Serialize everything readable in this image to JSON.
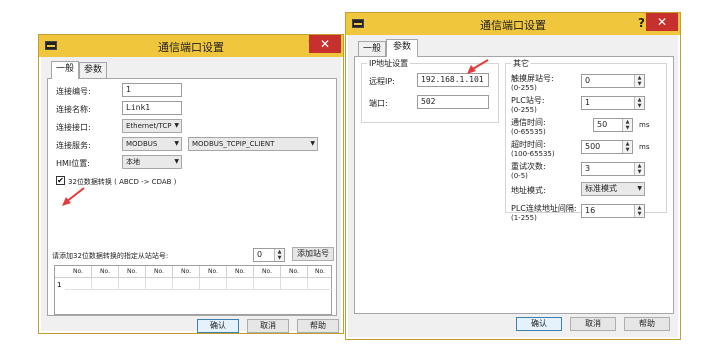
{
  "colors": {
    "titlebar": "#f0c63c",
    "close": "#c7312d",
    "arrow": "#e23b3b"
  },
  "dialog1": {
    "title": "通信端口设置",
    "help": "?",
    "close": "✕",
    "tabs": [
      "一般",
      "参数"
    ],
    "fields": {
      "conn_no": {
        "label": "连接编号:",
        "value": "1"
      },
      "conn_name": {
        "label": "连接名称:",
        "value": "Link1"
      },
      "conn_port": {
        "label": "连接接口:",
        "value": "Ethernet/TCP"
      },
      "conn_service": {
        "label": "连接服务:",
        "value": "MODBUS",
        "value2": "MODBUS_TCPIP_CLIENT"
      },
      "hmi_pos": {
        "label": "HMI位置:",
        "value": "本地"
      }
    },
    "checkbox_label": "32位数据转换 ( ABCD -> CDAB )",
    "station_label": "请添加32位数据转换的指定从站站号:",
    "station_value": "0",
    "add_station": "添加站号",
    "grid_headers": [
      "No.",
      "No.",
      "No.",
      "No.",
      "No.",
      "No.",
      "No.",
      "No.",
      "No.",
      "No."
    ],
    "grid_row_label": "1",
    "ok": "确认",
    "cancel": "取消",
    "help_btn": "帮助"
  },
  "dialog2": {
    "title": "通信端口设置",
    "help": "?",
    "close": "✕",
    "tabs": [
      "一般",
      "参数"
    ],
    "ip_group": "IP地址设置",
    "remote_ip_label": "远程IP:",
    "remote_ip": "192.168.1.101",
    "port_label": "端口:",
    "port": "502",
    "other_group": "其它",
    "touch_station": {
      "label": "触摸屏站号:",
      "range": "(0-255)",
      "value": "0"
    },
    "plc_station": {
      "label": "PLC站号:",
      "range": "(0-255)",
      "value": "1"
    },
    "comm_time": {
      "label": "通信时间:",
      "range": "(0-65535)",
      "value": "50",
      "unit": "ms"
    },
    "timeout": {
      "label": "超时时间:",
      "range": "(100-65535)",
      "value": "500",
      "unit": "ms"
    },
    "retries": {
      "label": "重试次数:",
      "range": "(0-5)",
      "value": "3"
    },
    "addr_mode": {
      "label": "地址模式:",
      "value": "标准模式"
    },
    "plc_interval": {
      "label": "PLC连续地址间隔:",
      "range": "(1-255)",
      "value": "16"
    },
    "ok": "确认",
    "cancel": "取消",
    "help_btn": "帮助"
  }
}
